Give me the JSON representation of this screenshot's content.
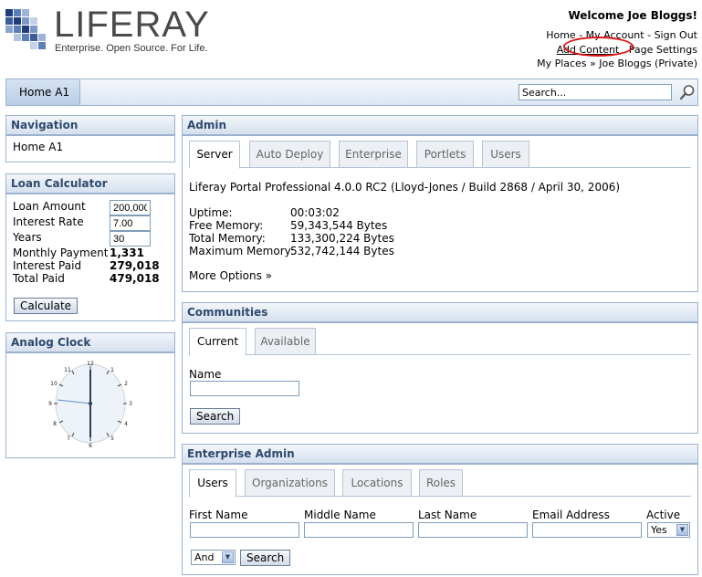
{
  "logo": {
    "word": "LIFERAY",
    "tagline": "Enterprise. Open Source. For Life."
  },
  "header": {
    "welcome": "Welcome Joe Bloggs!",
    "links": {
      "home": "Home",
      "my_account": "My Account",
      "sign_out": "Sign Out",
      "add_content": "Add Content",
      "page_settings": "Page Settings",
      "my_places": "My Places",
      "current_place": "Joe Bloggs (Private)"
    },
    "separator": " - ",
    "arrow": " » "
  },
  "navbar": {
    "tab": "Home A1",
    "search_value": "Search..."
  },
  "navigation": {
    "title": "Navigation",
    "items": [
      "Home A1"
    ]
  },
  "loan": {
    "title": "Loan Calculator",
    "loan_amount_label": "Loan Amount",
    "loan_amount": "200,000",
    "interest_rate_label": "Interest Rate",
    "interest_rate": "7.00",
    "years_label": "Years",
    "years": "30",
    "monthly_payment_label": "Monthly Payment",
    "monthly_payment": "1,331",
    "interest_paid_label": "Interest Paid",
    "interest_paid": "279,018",
    "total_paid_label": "Total Paid",
    "total_paid": "479,018",
    "calculate": "Calculate"
  },
  "clock": {
    "title": "Analog Clock"
  },
  "admin": {
    "title": "Admin",
    "tabs": [
      "Server",
      "Auto Deploy",
      "Enterprise",
      "Portlets",
      "Users"
    ],
    "version": "Liferay Portal Professional 4.0.0 RC2 (Lloyd-Jones / Build 2868 / April 30, 2006)",
    "stats": [
      {
        "label": "Uptime:",
        "value": "00:03:02"
      },
      {
        "label": "Free Memory:",
        "value": "59,343,544 Bytes"
      },
      {
        "label": "Total Memory:",
        "value": "133,300,224 Bytes"
      },
      {
        "label": "Maximum Memory:",
        "value": "532,742,144 Bytes"
      }
    ],
    "more": "More Options »"
  },
  "communities": {
    "title": "Communities",
    "tabs": [
      "Current",
      "Available"
    ],
    "name_label": "Name",
    "search": "Search"
  },
  "enterprise_admin": {
    "title": "Enterprise Admin",
    "tabs": [
      "Users",
      "Organizations",
      "Locations",
      "Roles"
    ],
    "fields": [
      "First Name",
      "Middle Name",
      "Last Name",
      "Email Address"
    ],
    "active_label": "Active",
    "active_value": "Yes",
    "andor_value": "And",
    "search": "Search"
  }
}
